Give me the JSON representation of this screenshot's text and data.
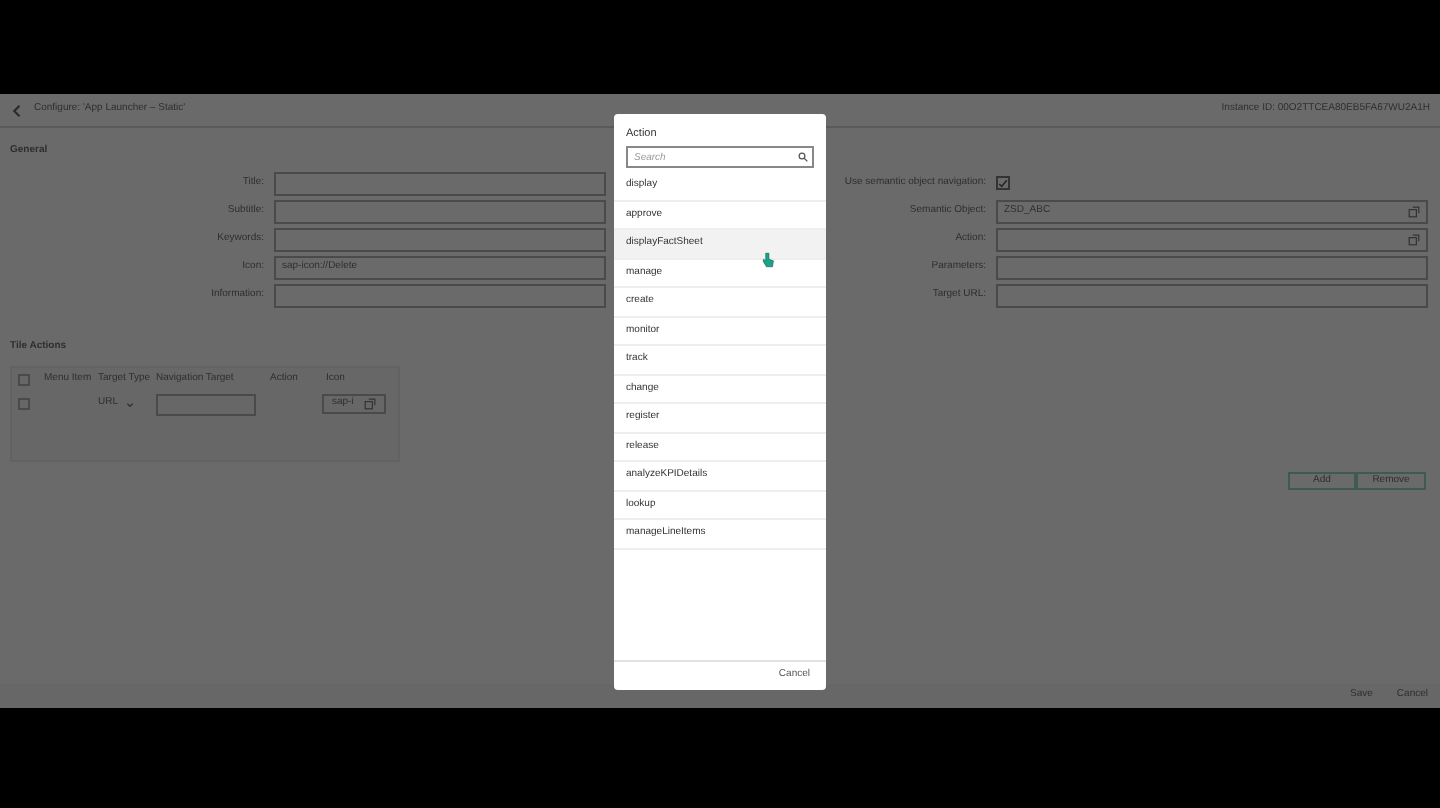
{
  "header": {
    "title": "Configure: 'App Launcher – Static'",
    "instance": "Instance ID: 00O2TTCEA80EB5FA67WU2A1H"
  },
  "general": {
    "heading": "General",
    "left_fields": [
      {
        "label": "Title:"
      },
      {
        "label": "Subtitle:"
      },
      {
        "label": "Keywords:"
      },
      {
        "label": "Icon:",
        "value": "sap-icon://Delete"
      },
      {
        "label": "Information:"
      }
    ],
    "semantic_nav": {
      "label": "Use semantic object navigation:",
      "checked": true
    },
    "right_fields": [
      {
        "label": "Semantic Object:",
        "value": "ZSD_ABC",
        "value_help": true
      },
      {
        "label": "Action:",
        "value_help": true
      },
      {
        "label": "Parameters:",
        "value_help": false
      },
      {
        "label": "Target URL:",
        "value_help": false
      }
    ]
  },
  "tile_actions": {
    "heading": "Tile Actions",
    "columns": [
      "Menu Item",
      "Target Type",
      "Navigation Target",
      "Action",
      "Icon"
    ],
    "header_checked": false,
    "rows": [
      {
        "checked": false,
        "target_type": "URL",
        "icon": "sap-i"
      }
    ],
    "buttons": [
      "Add",
      "Remove"
    ]
  },
  "footer": {
    "buttons": [
      "Save",
      "Cancel"
    ]
  },
  "dialog": {
    "title": "Action",
    "search": {
      "placeholder": "Search"
    },
    "items": [
      {
        "label": "display",
        "selected": false
      },
      {
        "label": "approve",
        "selected": false
      },
      {
        "label": "displayFactSheet",
        "selected": true
      },
      {
        "label": "manage",
        "selected": false
      },
      {
        "label": "create",
        "selected": false
      },
      {
        "label": "monitor",
        "selected": false
      },
      {
        "label": "track",
        "selected": false
      },
      {
        "label": "change",
        "selected": false
      },
      {
        "label": "register",
        "selected": false
      },
      {
        "label": "release",
        "selected": false
      },
      {
        "label": "analyzeKPIDetails",
        "selected": false
      },
      {
        "label": "lookup",
        "selected": false
      },
      {
        "label": "manageLineItems",
        "selected": false
      }
    ],
    "cancel": "Cancel"
  }
}
